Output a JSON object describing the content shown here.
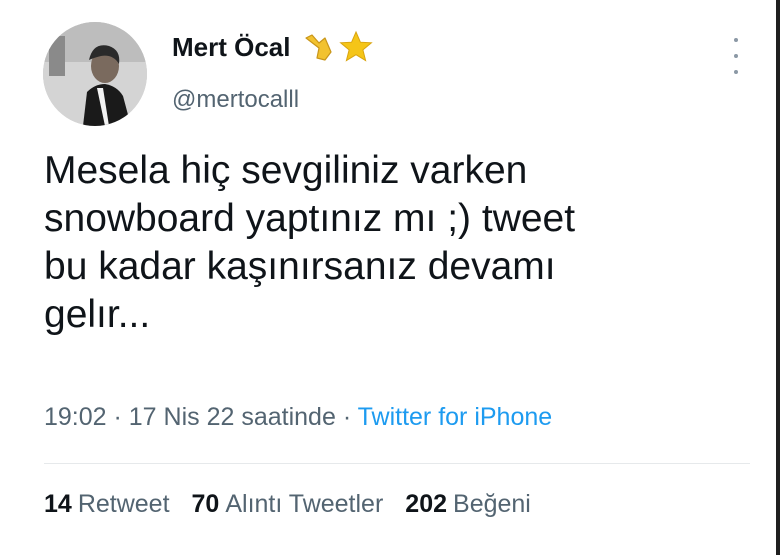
{
  "user": {
    "display_name": "Mert Öcal",
    "handle": "@mertocalll",
    "name_emojis": [
      "shaka-hand-icon",
      "star-icon"
    ]
  },
  "tweet": {
    "lines": [
      "Mesela hiç sevgiliniz varken",
      "snowboard yaptınız mı ;) tweet",
      "bu kadar kaşınırsanız devamı",
      "gelır..."
    ]
  },
  "meta": {
    "time": "19:02",
    "separator": " · ",
    "date": "17 Nis 22 saatinde",
    "separator2": " · ",
    "source": "Twitter for iPhone"
  },
  "stats": [
    {
      "count": "14",
      "label": "Retweet"
    },
    {
      "count": "70",
      "label": "Alıntı Tweetler"
    },
    {
      "count": "202",
      "label": "Beğeni"
    }
  ],
  "colors": {
    "text": "#0f1419",
    "secondary": "#536471",
    "link": "#1d9bf0",
    "star": "#f5c518"
  }
}
